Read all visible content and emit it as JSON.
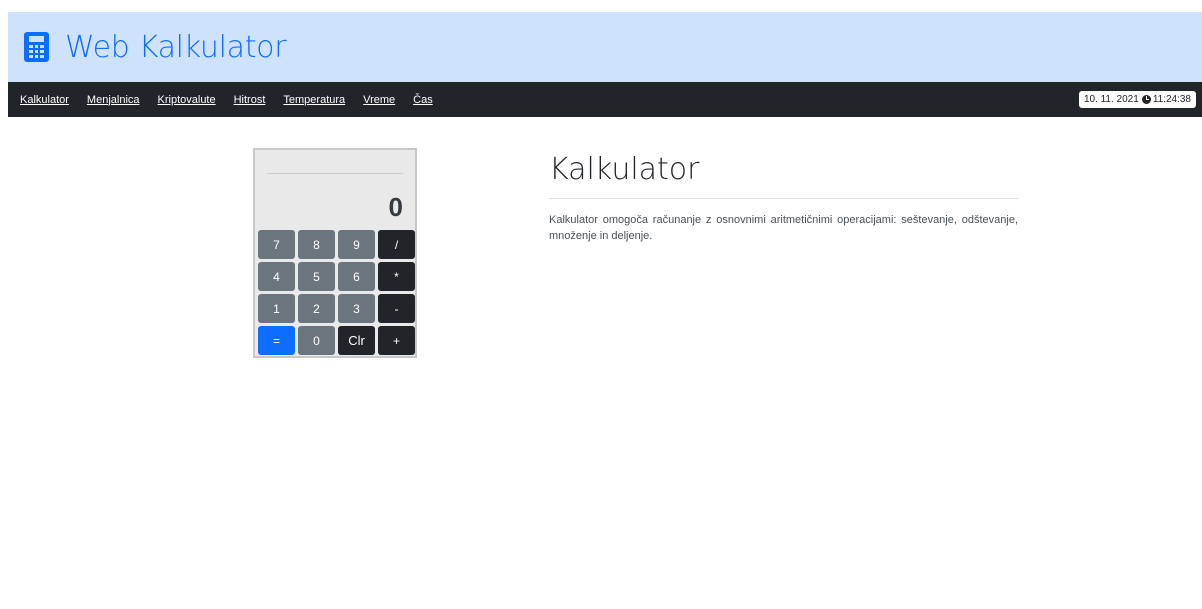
{
  "header": {
    "icon": "calculator-icon",
    "title": "Web Kalkulator"
  },
  "nav": {
    "items": [
      {
        "label": "Kalkulator"
      },
      {
        "label": "Menjalnica"
      },
      {
        "label": "Kriptovalute"
      },
      {
        "label": "Hitrost"
      },
      {
        "label": "Temperatura"
      },
      {
        "label": "Vreme"
      },
      {
        "label": "Čas"
      }
    ],
    "date": "10. 11. 2021",
    "time": "11:24:38",
    "clock_icon": "clock-icon"
  },
  "calculator": {
    "display": "0",
    "keys": [
      {
        "label": "7",
        "kind": "num"
      },
      {
        "label": "8",
        "kind": "num"
      },
      {
        "label": "9",
        "kind": "num"
      },
      {
        "label": "/",
        "kind": "op"
      },
      {
        "label": "4",
        "kind": "num"
      },
      {
        "label": "5",
        "kind": "num"
      },
      {
        "label": "6",
        "kind": "num"
      },
      {
        "label": "*",
        "kind": "op"
      },
      {
        "label": "1",
        "kind": "num"
      },
      {
        "label": "2",
        "kind": "num"
      },
      {
        "label": "3",
        "kind": "num"
      },
      {
        "label": "-",
        "kind": "op"
      },
      {
        "label": "=",
        "kind": "eq"
      },
      {
        "label": "0",
        "kind": "num"
      },
      {
        "label": "Clr",
        "kind": "clr"
      },
      {
        "label": "+",
        "kind": "op"
      }
    ]
  },
  "content": {
    "title": "Kalkulator",
    "description": "Kalkulator omogoča računanje z osnovnimi aritmetičnimi operacijami: seštevanje, odštevanje, množenje in deljenje."
  },
  "colors": {
    "header_bg": "#cfe2fc",
    "accent": "#0d6efd",
    "navbar_bg": "#212529",
    "key_num": "#6c757d",
    "key_op": "#212529"
  }
}
